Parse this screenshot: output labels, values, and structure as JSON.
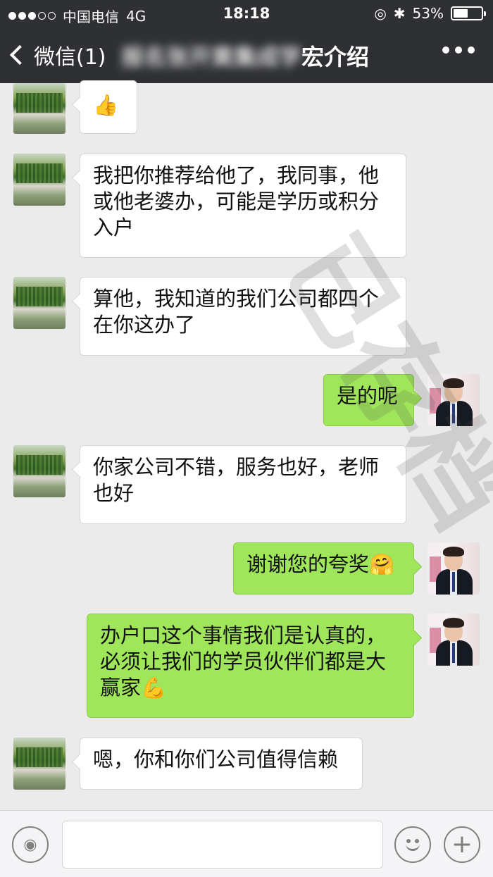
{
  "status_bar": {
    "carrier": "中国电信",
    "network": "4G",
    "time": "18:18",
    "battery_text": "53%",
    "battery_level": 0.53,
    "signal_bars": 3,
    "signal_total": 5
  },
  "nav": {
    "back_label": "微信(1)",
    "title_obscured": "报名张开黄集成学",
    "title_visible": "宏介绍"
  },
  "messages": [
    {
      "side": "in",
      "icon": "thumbs-up-icon",
      "text": "👍"
    },
    {
      "side": "in",
      "text": "我把你推荐给他了，我同事，他或他老婆办，可能是学历或积分入户"
    },
    {
      "side": "in",
      "text": "算他，我知道的我们公司都四个在你这办了"
    },
    {
      "side": "out",
      "text": "是的呢"
    },
    {
      "side": "in",
      "text": "你家公司不错，服务也好，老师也好"
    },
    {
      "side": "out",
      "text": "谢谢您的夸奖",
      "emoji": "🤗"
    },
    {
      "side": "out",
      "text": "办户口这个事情我们是认真的，必须让我们的学员伙伴们都是大赢家",
      "emoji": "💪"
    },
    {
      "side": "in",
      "text": "嗯，你和你们公司值得信赖"
    }
  ],
  "watermark": "已存档",
  "colors": {
    "nav_bg": "#2e3033",
    "chat_bg": "#ebebeb",
    "outgoing_bubble": "#9fe65a",
    "incoming_bubble": "#ffffff"
  }
}
